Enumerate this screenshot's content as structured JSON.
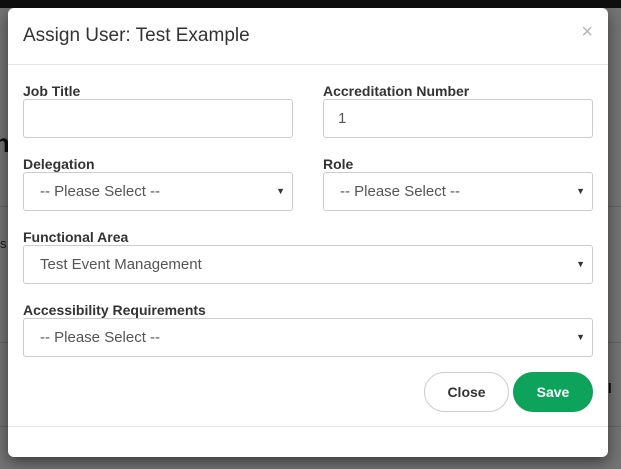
{
  "background": {
    "heading_fragment": "h",
    "small_fragment": "s",
    "right_fragment": "ll"
  },
  "modal": {
    "title": "Assign User: Test Example",
    "close_glyph": "×"
  },
  "form": {
    "job_title": {
      "label": "Job Title",
      "value": ""
    },
    "accreditation_number": {
      "label": "Accreditation Number",
      "value": "1"
    },
    "delegation": {
      "label": "Delegation",
      "selected": "-- Please Select --"
    },
    "role": {
      "label": "Role",
      "selected": "-- Please Select --"
    },
    "functional_area": {
      "label": "Functional Area",
      "selected": "Test Event Management"
    },
    "accessibility": {
      "label": "Accessibility Requirements",
      "selected": "-- Please Select --"
    },
    "caret_glyph": "▼"
  },
  "footer": {
    "close_label": "Close",
    "save_label": "Save"
  },
  "colors": {
    "save_button": "#0ea35a",
    "overlay": "#000000"
  },
  "icons": {
    "close": "close-icon",
    "caret": "chevron-down-icon"
  }
}
